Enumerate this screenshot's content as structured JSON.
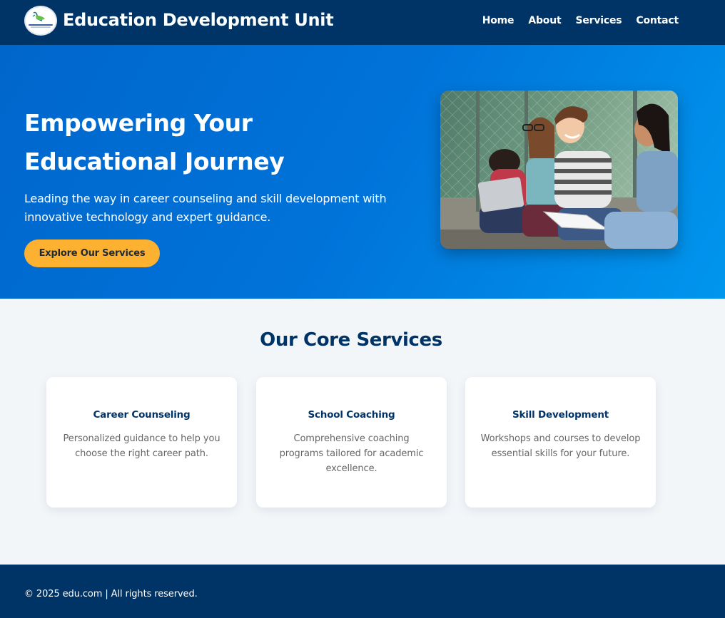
{
  "header": {
    "title": "Education Development Unit",
    "logo_text": "Education Development Unit",
    "nav": [
      "Home",
      "About",
      "Services",
      "Contact"
    ]
  },
  "hero": {
    "title_line1": "Empowering Your",
    "title_line2": "Educational Journey",
    "subtitle": "Leading the way in career counseling and skill development with innovative technology and expert guidance.",
    "cta_label": "Explore Our Services"
  },
  "services": {
    "title": "Our Core Services",
    "cards": [
      {
        "title": "Career Counseling",
        "description": "Personalized guidance to help you choose the right career path."
      },
      {
        "title": "School Coaching",
        "description": "Comprehensive coaching programs tailored for academic excellence."
      },
      {
        "title": "Skill Development",
        "description": "Workshops and courses to develop essential skills for your future."
      }
    ]
  },
  "footer": {
    "text": "© 2025 edu.com | All rights reserved."
  },
  "colors": {
    "primary_dark": "#003366",
    "hero_blue": "#0073d9",
    "accent_yellow": "#fcb131",
    "background": "#f3f6f9"
  }
}
